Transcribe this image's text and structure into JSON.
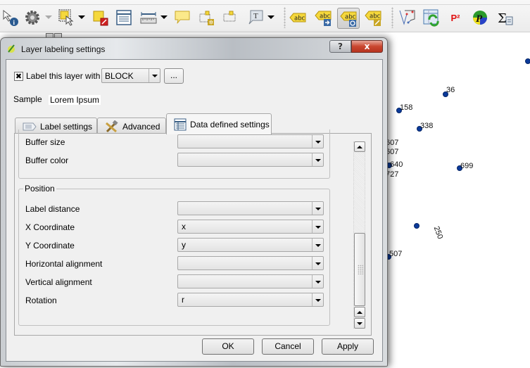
{
  "toolbar": {
    "buttons": [
      {
        "name": "identify-features",
        "icon": "identify-icon"
      },
      {
        "name": "run-feature-action",
        "icon": "gear-icon"
      },
      {
        "name": "select-features",
        "icon": "select-icon"
      },
      {
        "name": "deselect-all",
        "icon": "deselect-icon"
      },
      {
        "name": "open-attribute-table",
        "icon": "attribute-table-icon"
      },
      {
        "name": "measure-line",
        "icon": "ruler-icon"
      },
      {
        "name": "map-tips",
        "icon": "speech-bubble-icon"
      },
      {
        "name": "new-bookmark",
        "icon": "new-bookmark-icon"
      },
      {
        "name": "show-bookmarks",
        "icon": "bookmarks-icon"
      },
      {
        "name": "text-annotation",
        "icon": "text-annotation-icon"
      },
      {
        "name": "layer-labeling",
        "icon": "label-abc-icon",
        "text": "abc"
      },
      {
        "name": "move-label",
        "icon": "move-label-icon",
        "text": "abc"
      },
      {
        "name": "rotate-label",
        "icon": "rotate-label-icon",
        "text": "abc",
        "active": true
      },
      {
        "name": "change-label",
        "icon": "change-label-icon",
        "text": "abc"
      },
      {
        "name": "digitize-tool",
        "icon": "digitize-icon"
      },
      {
        "name": "refresh-table",
        "icon": "table-refresh-icon"
      },
      {
        "name": "postgis-plugin",
        "icon": "p2-icon",
        "text": "P²"
      },
      {
        "name": "python-plugin",
        "icon": "python-p-icon",
        "text": "P"
      },
      {
        "name": "field-calculator",
        "icon": "sigma-calculator-icon",
        "text": "Σ"
      }
    ]
  },
  "map": {
    "points": [
      {
        "label": "36"
      },
      {
        "label": "158"
      },
      {
        "label": "338"
      },
      {
        "label": "699"
      },
      {
        "label": "250",
        "rotated": true
      },
      {
        "label": "507"
      },
      {
        "label": "607"
      },
      {
        "label": "607"
      },
      {
        "label": "640"
      },
      {
        "label": "727"
      }
    ],
    "point_color": "#0b3a9a"
  },
  "dialog": {
    "title": "Layer labeling settings",
    "help_label": "?",
    "close_label": "x",
    "label_layer_checkbox": {
      "label": "Label this layer with",
      "checked": true,
      "mark": "✖"
    },
    "field_combo": {
      "value": "BLOCK"
    },
    "expression_button": "...",
    "sample_label": "Sample",
    "sample_text": "Lorem Ipsum",
    "tabs": [
      {
        "label": "Label settings",
        "icon": "label-settings-icon"
      },
      {
        "label": "Advanced",
        "icon": "tools-icon"
      },
      {
        "label": "Data defined settings",
        "icon": "table-icon",
        "selected": true
      }
    ],
    "buffer_group": {
      "rows": [
        {
          "label": "Buffer size",
          "value": ""
        },
        {
          "label": "Buffer color",
          "value": ""
        }
      ]
    },
    "position_group": {
      "title": "Position",
      "rows": [
        {
          "label": "Label distance",
          "value": ""
        },
        {
          "label": "X Coordinate",
          "value": "x"
        },
        {
          "label": "Y Coordinate",
          "value": "y"
        },
        {
          "label": "Horizontal alignment",
          "value": ""
        },
        {
          "label": "Vertical alignment",
          "value": ""
        },
        {
          "label": "Rotation",
          "value": "r"
        }
      ]
    },
    "buttons": {
      "ok": "OK",
      "cancel": "Cancel",
      "apply": "Apply"
    }
  }
}
